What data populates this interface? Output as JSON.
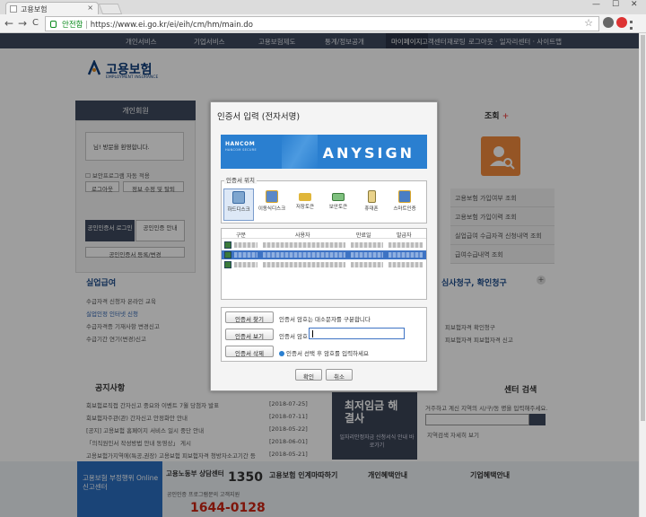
{
  "browser": {
    "tab_title": "고용보험",
    "tab_close": "×",
    "window_controls": [
      "—",
      "☐",
      "✕"
    ],
    "back": "←",
    "forward": "→",
    "reload": "C",
    "secure_label": "안전함",
    "url": "https://www.ei.go.kr/ei/eih/cm/hm/main.do"
  },
  "site": {
    "topnav": [
      "개인서비스",
      "기업서비스",
      "고용보험제도",
      "통계/정보공개",
      "마이페이지",
      "고객센터",
      "재로팅",
      "로그아웃 · 일자리센터 · 사이트맵"
    ],
    "logo_name": "고용보험",
    "logo_sub": "EMPLOYMENT INSURANCE",
    "left_title": "개인회원",
    "welcome": "님! 방문을 환영합니다.",
    "security_line": "보안프로그램 자동 적용",
    "logout_btn": "로그아웃",
    "profile_btn": "정보 수정 및 탈퇴",
    "cert_login": "공인인증서 로그인",
    "cert_guide": "공인인증 안내",
    "cert_register": "공인인증서 등록/변경",
    "unemployment_title": "실업급여",
    "unemployment_items": [
      "수급자격 신청자 온라인 교육",
      "실업인정 인터넷 신청",
      "수급자격증 기재사항 변경신고",
      "수급기간 연기(변경)신고"
    ],
    "notice_title": "공지사항",
    "notice_items": [
      {
        "text": "회보험료직접 간자신고 중요와 이벤트 7월 당첨자 발표",
        "date": "[2018-07-25]"
      },
      {
        "text": "회보험자주관(관) 간자신고 안정화안 안내",
        "date": "[2018-07-11]"
      },
      {
        "text": "[공지] 고용보험 홈페이지 서비스 일시 중단 안내",
        "date": "[2018-05-22]"
      },
      {
        "text": "「의직원인서 작성방법 안내 동영상」 게시",
        "date": "[2018-06-01]"
      },
      {
        "text": "고용보험가지역에(특공,권장) 고용보험 피보험자격 청방자소고기간 등",
        "date": "[2018-05-21]"
      }
    ],
    "right_title": "조회",
    "right_items": [
      "고용보험 가입여부 조회",
      "고용보험 가입이력 조회",
      "실업급여 수급자격 신청내역 조회",
      "급여수급내역 조회"
    ],
    "claim_title": "심사청구, 확인청구",
    "claim_items": [
      "피보험자격 확인청구",
      "피보험자격 피보험자격 신고"
    ],
    "search_title": "센터 검색",
    "search_desc": "거주하고 계신 지역의 시/구/동 명을 입력해주세요.",
    "search_region": "지역검색 자세히 보기",
    "min_wage": "최저임금 해결사",
    "min_wage_sub": "일자리안정자금 신청서식 안내 바로가기",
    "online_report": "고용보험 부정행위 Online 신고센터",
    "call_center": "고용노동부 상담센터",
    "call_number": "1350",
    "cert_center": "공인인증 프로그램문의 고객지원",
    "cert_phone": "1644-0128",
    "benefit1": "고용보험 인계마따하기",
    "benefit2": "개인혜택안내",
    "benefit3": "기업혜택안내"
  },
  "dialog": {
    "title": "인증서 입력 (전자서명)",
    "vendor": "HANCOM",
    "vendor_sub": "HANCOM SECURE",
    "product": "ANYSIGN",
    "location_label": "인증서 위치",
    "devices": [
      "하드디스크",
      "이동식디스크",
      "저장토큰",
      "보안토큰",
      "휴대폰",
      "스마트인증"
    ],
    "columns": [
      "구분",
      "사용자",
      "만료일",
      "발급자"
    ],
    "find_btn": "인증서 찾기",
    "find_text": "인증서 암호는 대소문자를 구분합니다",
    "view_btn": "인증서 보기",
    "password_label": "인증서 암호",
    "delete_btn": "인증서 삭제",
    "delete_text": "인증서 선택 후 암호를 입력하세요",
    "ok": "확인",
    "cancel": "취소"
  }
}
